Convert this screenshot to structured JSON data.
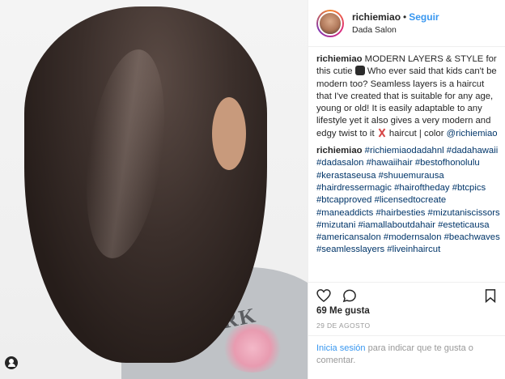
{
  "header": {
    "username": "richiemiao",
    "separator": "•",
    "follow_label": "Seguir",
    "location": "Dada Salon"
  },
  "caption": {
    "author": "richiemiao",
    "text_part1": "MODERN LAYERS & STYLE for this cutie",
    "text_part2": "Who ever said that kids can't be modern too? Seamless layers is a haircut that I've created that is suitable for any age, young or old! It is easily adaptable to any lifestyle yet it also gives a very modern and edgy twist to it",
    "text_part3": "haircut | color",
    "mention": "@richiemiao"
  },
  "comment": {
    "author": "richiemiao",
    "hashtags": [
      "#richiemiaodadahnl",
      "#dadahawaii",
      "#dadasalon",
      "#hawaiihair",
      "#bestofhonolulu",
      "#kerastaseusa",
      "#shuuemurausa",
      "#hairdressermagic",
      "#hairoftheday",
      "#btcpics",
      "#btcapproved",
      "#licensedtocreate",
      "#maneaddicts",
      "#hairbesties",
      "#mizutaniscissors",
      "#mizutani",
      "#iamallaboutdahair",
      "#esteticausa",
      "#americansalon",
      "#modernsalon",
      "#beachwaves",
      "#seamlesslayers",
      "#liveinhaircut"
    ]
  },
  "photo": {
    "shirt_print": "NEW YORK"
  },
  "stats": {
    "likes": "69 Me gusta",
    "date": "29 DE AGOSTO"
  },
  "login": {
    "link_label": "Inicia sesión",
    "rest_label": "para indicar que te gusta o comentar."
  },
  "icons": {
    "like": "heart-icon",
    "comment": "comment-icon",
    "bookmark": "bookmark-icon",
    "user_tag": "user-tag-icon",
    "emoji_1": "face-emoji-icon",
    "emoji_2": "scissors-emoji-icon"
  },
  "colors": {
    "accent": "#3897f0",
    "hashtag": "#003569",
    "muted": "#999999",
    "text": "#262626"
  }
}
